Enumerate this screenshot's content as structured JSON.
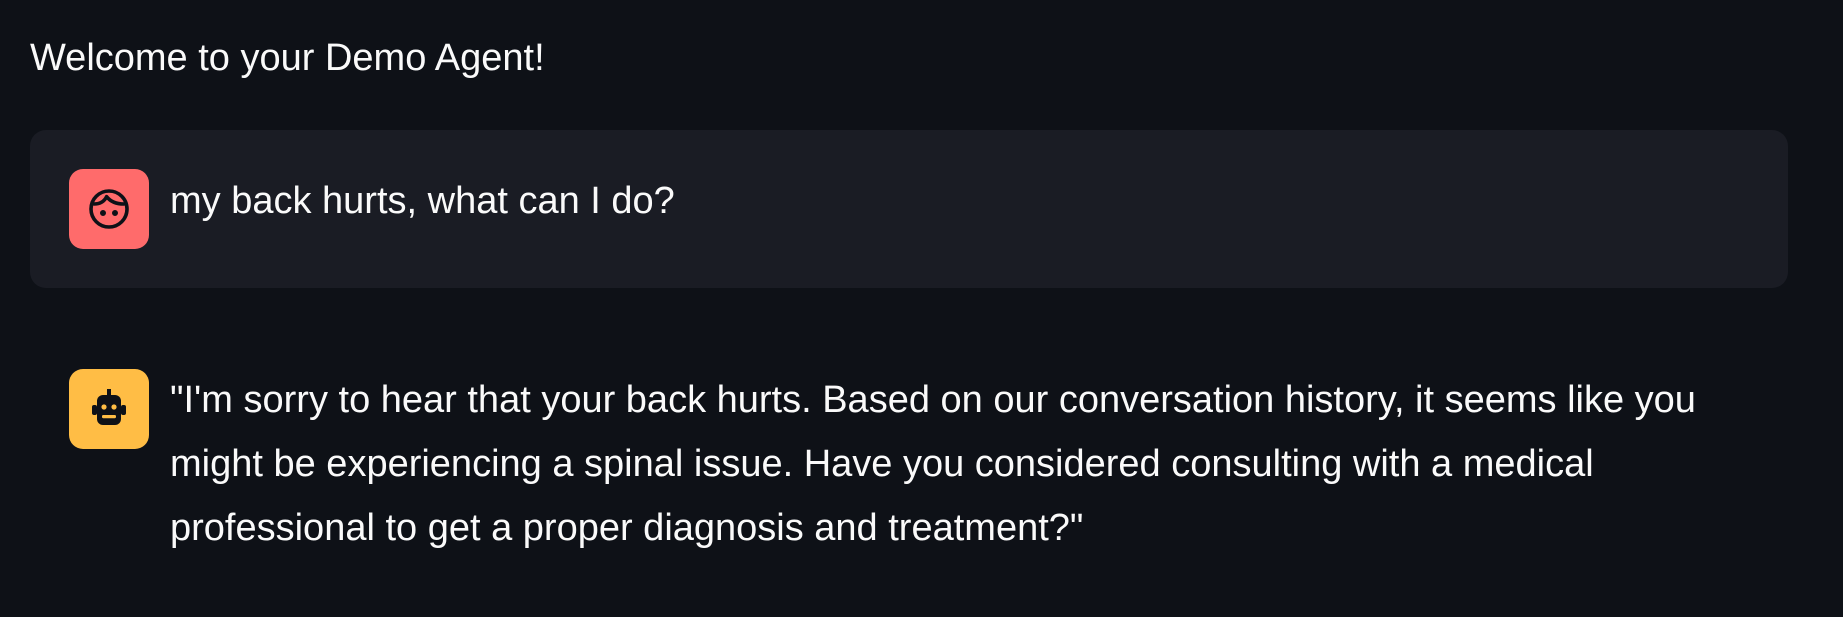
{
  "app": {
    "welcome_text": "Welcome to your Demo Agent!"
  },
  "chat": {
    "messages": [
      {
        "role": "user",
        "avatar_icon": "face-icon",
        "avatar_color": "#ff6b6b",
        "text": "my back hurts, what can I do?"
      },
      {
        "role": "assistant",
        "avatar_icon": "robot-icon",
        "avatar_color": "#ffbd45",
        "text": "\"I'm sorry to hear that your back hurts. Based on our conversation history, it seems like you might be experiencing a spinal issue. Have you considered consulting with a medical professional to get a proper diagnosis and treatment?\""
      }
    ]
  },
  "colors": {
    "background": "#0e1117",
    "user_message_background": "#1a1c24",
    "text": "#fafafa"
  }
}
